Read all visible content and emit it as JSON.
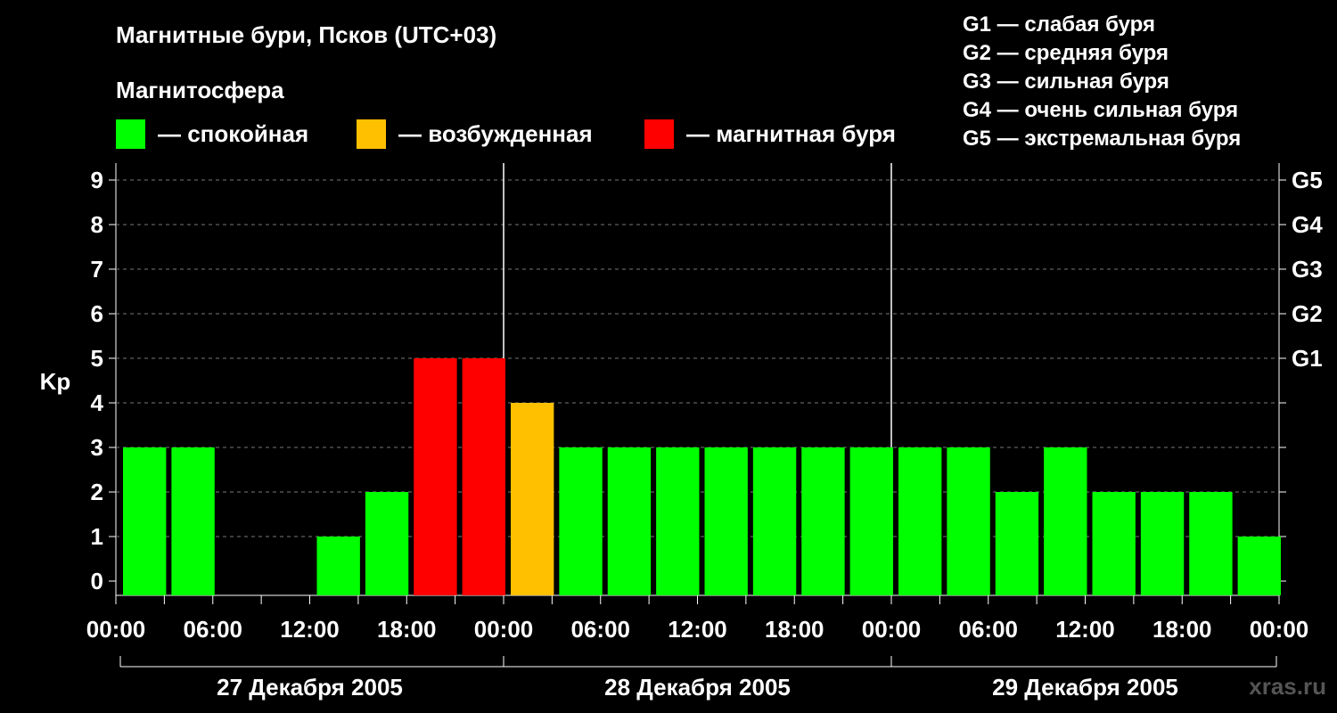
{
  "title": "Магнитные бури, Псков (UTC+03)",
  "subtitle": "Магнитосфера",
  "legend": [
    {
      "color": "#00ff00",
      "label": "— спокойная"
    },
    {
      "color": "#ffc000",
      "label": "— возбужденная"
    },
    {
      "color": "#ff0000",
      "label": "— магнитная буря"
    }
  ],
  "g_scale": [
    "G1 — слабая буря",
    "G2 — средняя буря",
    "G3 — сильная буря",
    "G4 — очень сильная буря",
    "G5 — экстремальная буря"
  ],
  "watermark": "xras.ru",
  "chart_data": {
    "type": "bar",
    "ylabel": "Kp",
    "ylim": [
      0,
      9
    ],
    "yticks": [
      "0",
      "1",
      "2",
      "3",
      "4",
      "5",
      "6",
      "7",
      "8",
      "9"
    ],
    "right_ticks": [
      {
        "value": 5,
        "label": "G1"
      },
      {
        "value": 6,
        "label": "G2"
      },
      {
        "value": 7,
        "label": "G3"
      },
      {
        "value": 8,
        "label": "G4"
      },
      {
        "value": 9,
        "label": "G5"
      }
    ],
    "x_tick_labels": [
      "00:00",
      "06:00",
      "12:00",
      "18:00",
      "00:00",
      "06:00",
      "12:00",
      "18:00",
      "00:00",
      "06:00",
      "12:00",
      "18:00",
      "00:00"
    ],
    "days": [
      "27 Декабря 2005",
      "28 Декабря 2005",
      "29 Декабря 2005"
    ],
    "categories": [
      "27.12 00:00",
      "27.12 03:00",
      "27.12 06:00",
      "27.12 09:00",
      "27.12 12:00",
      "27.12 15:00",
      "27.12 18:00",
      "27.12 21:00",
      "28.12 00:00",
      "28.12 03:00",
      "28.12 06:00",
      "28.12 09:00",
      "28.12 12:00",
      "28.12 15:00",
      "28.12 18:00",
      "28.12 21:00",
      "29.12 00:00",
      "29.12 03:00",
      "29.12 06:00",
      "29.12 09:00",
      "29.12 12:00",
      "29.12 15:00",
      "29.12 18:00",
      "29.12 21:00"
    ],
    "values": [
      3,
      3,
      0,
      0,
      1,
      2,
      5,
      5,
      4,
      3,
      3,
      3,
      3,
      3,
      3,
      3,
      3,
      3,
      2,
      3,
      2,
      2,
      2,
      1
    ],
    "colors": {
      "calm": "#00ff00",
      "active": "#ffc000",
      "storm": "#ff0000"
    },
    "grid": true
  }
}
